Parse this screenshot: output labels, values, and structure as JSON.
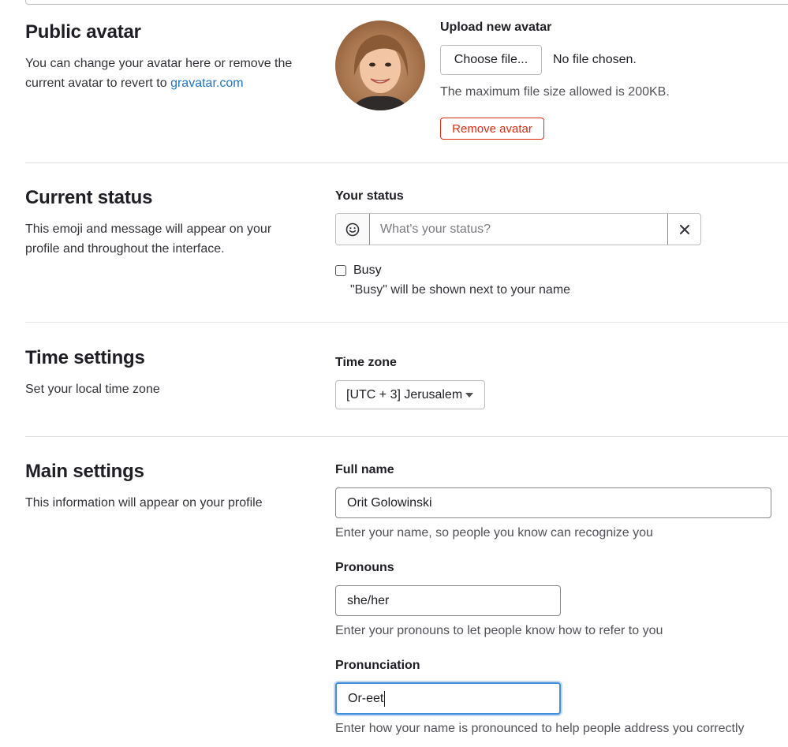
{
  "public_avatar": {
    "title": "Public avatar",
    "desc_prefix": "You can change your avatar here or remove the current avatar to revert to ",
    "desc_link": "gravatar.com",
    "upload_label": "Upload new avatar",
    "choose_button": "Choose file...",
    "no_file": "No file chosen.",
    "max_size": "The maximum file size allowed is 200KB.",
    "remove_button": "Remove avatar"
  },
  "current_status": {
    "title": "Current status",
    "desc": "This emoji and message will appear on your profile and throughout the interface.",
    "your_status_label": "Your status",
    "status_placeholder": "What's your status?",
    "emoji_icon": "smiley-icon",
    "clear_icon": "close-icon",
    "busy_label": "Busy",
    "busy_checked": false,
    "busy_help": "\"Busy\" will be shown next to your name"
  },
  "time_settings": {
    "title": "Time settings",
    "desc": "Set your local time zone",
    "timezone_label": "Time zone",
    "timezone_value": "[UTC + 3] Jerusalem"
  },
  "main_settings": {
    "title": "Main settings",
    "desc": "This information will appear on your profile",
    "full_name_label": "Full name",
    "full_name_value": "Orit Golowinski",
    "full_name_help": "Enter your name, so people you know can recognize you",
    "pronouns_label": "Pronouns",
    "pronouns_value": "she/her",
    "pronouns_help": "Enter your pronouns to let people know how to refer to you",
    "pronunciation_label": "Pronunciation",
    "pronunciation_value": "Or-eet",
    "pronunciation_help": "Enter how your name is pronounced to help people address you correctly"
  },
  "colors": {
    "link": "#1f75cb",
    "danger": "#dd2b0e",
    "focus": "#428fdc"
  }
}
